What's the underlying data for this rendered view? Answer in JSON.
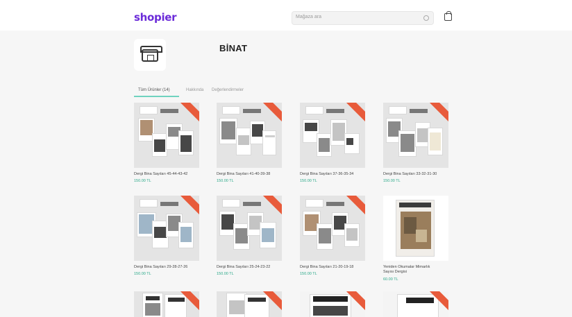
{
  "header": {
    "logo": "shopier",
    "search_placeholder": "Mağaza ara"
  },
  "store": {
    "name": "BİNAT"
  },
  "tabs": [
    {
      "label": "Tüm Ürünler (14)"
    },
    {
      "label": "Hakkında"
    },
    {
      "label": "Değerlendirmeler"
    }
  ],
  "products": [
    {
      "title": "Dergi Bina Sayıları 45-44-43-42",
      "price": "150.00 TL"
    },
    {
      "title": "Dergi Bina Sayıları 41-40-39-38",
      "price": "150.00 TL"
    },
    {
      "title": "Dergi Bina Sayıları 37-36-35-34",
      "price": "150.00 TL"
    },
    {
      "title": "Dergi Bina Sayıları 33-32-31-30",
      "price": "150.00 TL"
    },
    {
      "title": "Dergi Bina Sayıları 29-28-27-26",
      "price": "150.00 TL"
    },
    {
      "title": "Dergi Bina Sayıları 25-24-23-22",
      "price": "150.00 TL"
    },
    {
      "title": "Dergi Bina Sayıları 21-20-19-18",
      "price": "150.00 TL"
    },
    {
      "title": "Yeniden Okumalar Mimarlık Sayısı Dergisi",
      "price": "60.00 TL"
    },
    {
      "title": "",
      "price": ""
    },
    {
      "title": "",
      "price": ""
    },
    {
      "title": "",
      "price": ""
    },
    {
      "title": "",
      "price": ""
    }
  ],
  "colors": {
    "brand": "#6b2bd9",
    "accent": "#2aa888",
    "ribbon": "#e85b3b",
    "tab_underline": "#6fd3bf"
  },
  "icons": [
    "search-icon",
    "cart-icon",
    "store-icon"
  ]
}
